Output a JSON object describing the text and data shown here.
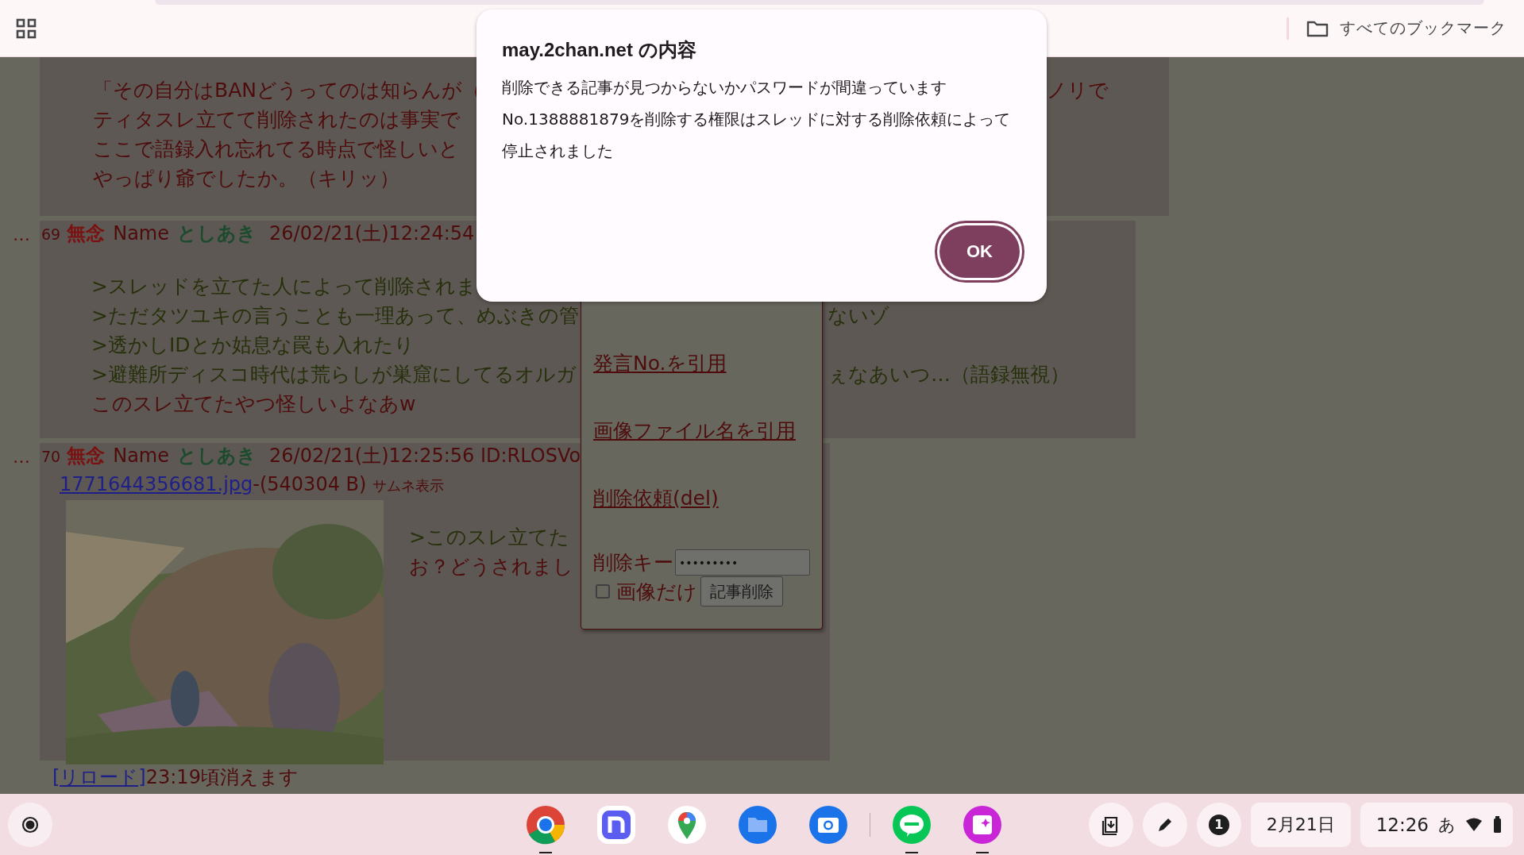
{
  "browser": {
    "bookmarks_label": "すべてのブックマーク"
  },
  "posts": [
    {
      "kind": "body",
      "lines": [
        {
          "text": "「その自分はBANどうってのは知らんが（",
          "quote": false,
          "tail": "ノリで"
        },
        {
          "text": "ティタスレ立てて削除されたのは事実で",
          "quote": false
        },
        {
          "text": "ここで語録入れ忘れてる時点で怪しいと",
          "quote": false
        },
        {
          "text": "やっぱり爺でしたか。（キリッ）",
          "quote": false
        }
      ]
    },
    {
      "kind": "reply",
      "mark": "…",
      "number": "69",
      "subject": "無念",
      "name_label": "Name",
      "name": "としあき",
      "datetime": "26/02/21(土)12:24:54",
      "lines": [
        {
          "text": ">スレッドを立てた人によって削除されま",
          "quote": true
        },
        {
          "text": ">ただタツユキの言うことも一理あって、めぶきの管",
          "quote": true,
          "tail": "ないゾ"
        },
        {
          "text": ">透かしIDとか姑息な罠も入れたり",
          "quote": true
        },
        {
          "text": ">避難所ディスコ時代は荒らしが巣窟にしてるオルガ",
          "quote": true,
          "tail": "ぇなあいつ…（語録無視）"
        },
        {
          "text": "このスレ立てたやつ怪しいよなあw",
          "quote": false
        }
      ]
    },
    {
      "kind": "reply",
      "mark": "…",
      "number": "70",
      "subject": "無念",
      "name_label": "Name",
      "name": "としあき",
      "datetime": "26/02/21(土)12:25:56 ID:RLOSVo",
      "file": {
        "name": "1771644356681.jpg",
        "size": "-(540304 B)",
        "thumb_label": "サムネ表示"
      },
      "image": {
        "kind": "picture"
      },
      "lines": [
        {
          "text": ">このスレ立てた",
          "quote": true
        },
        {
          "text": "お？どうされまし",
          "quote": false
        }
      ]
    }
  ],
  "footer": {
    "link": "[リロード]",
    "text": "23:19頃消えます"
  },
  "menu": {
    "items": [
      "発言No.を引用",
      "画像ファイル名を引用",
      "削除依頼(del)"
    ],
    "delete_key_label": "削除キー",
    "password_value": "•••••••••",
    "image_only": {
      "label": "画像だけ",
      "checked": false
    },
    "delete_button": "記事削除"
  },
  "dialog": {
    "title": "may.2chan.net の内容",
    "message": [
      "削除できる記事が見つからないかパスワードが間違っています",
      "No.1388881879を削除する権限はスレッドに対する削除依頼によって停止されました"
    ],
    "ok_button": "OK"
  },
  "shelf": {
    "apps": [
      {
        "kind": "chrome",
        "open": true
      },
      {
        "kind": "n",
        "open": false
      },
      {
        "kind": "maps",
        "open": false
      },
      {
        "kind": "files",
        "open": false
      },
      {
        "kind": "camera",
        "open": false
      },
      {
        "kind": "line",
        "open": true
      },
      {
        "kind": "gallery",
        "open": true
      }
    ],
    "notification_count": "1",
    "date": "2月21日",
    "time": "12:26",
    "ime": "あ"
  }
}
